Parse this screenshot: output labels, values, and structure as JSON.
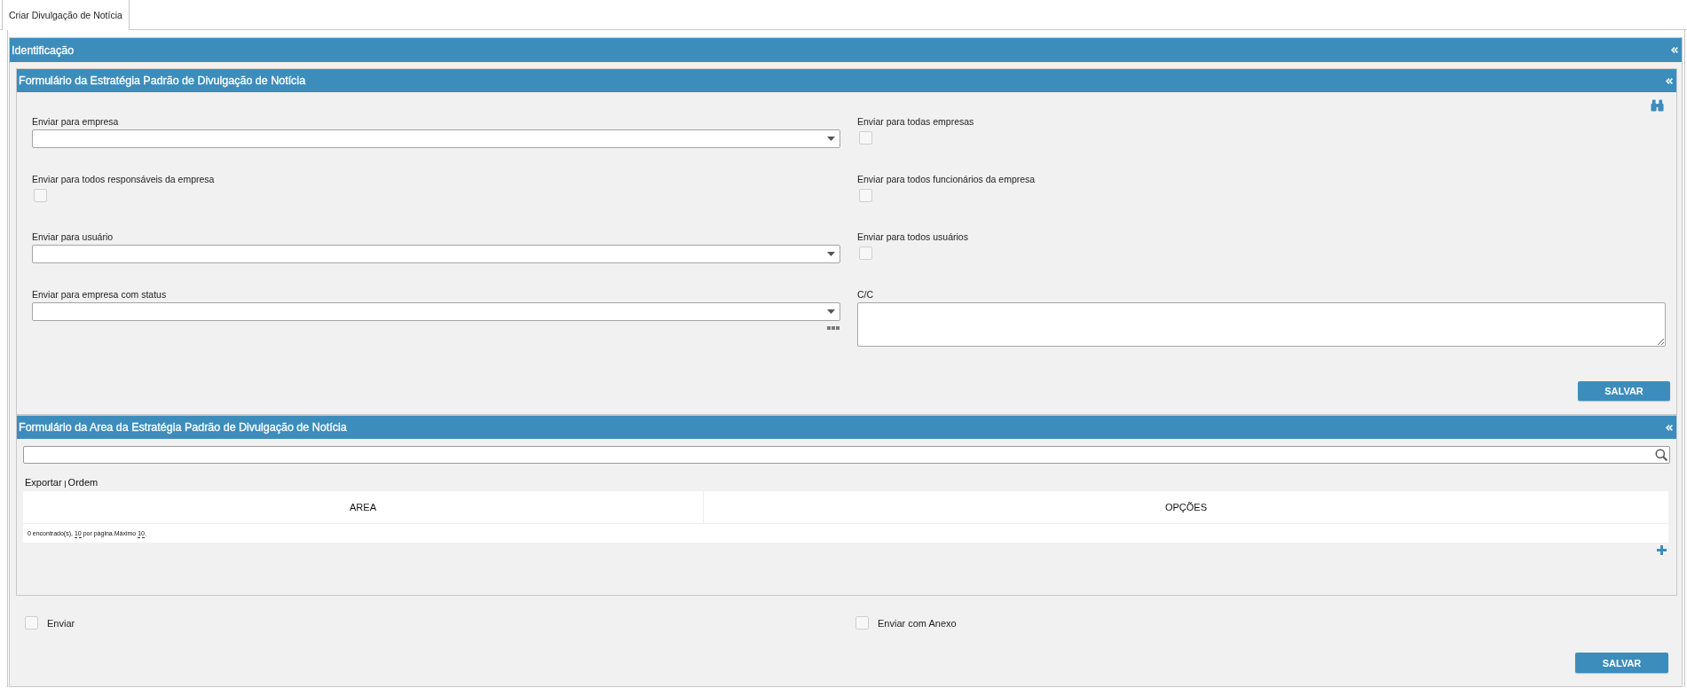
{
  "tab": {
    "label": "Criar Divulgação de Notícia",
    "selected": true
  },
  "identification": {
    "title": "Identificação",
    "strategy_form": {
      "title": "Formulário da Estratégia Padrão de Divulgação de Notícia",
      "fields": [
        {
          "kind": "select",
          "label": "Enviar para empresa"
        },
        {
          "kind": "checkbox",
          "label": "Enviar para todas empresas",
          "checked": false
        },
        {
          "kind": "checkbox",
          "label": "Enviar para todos responsáveis da empresa",
          "checked": false
        },
        {
          "kind": "checkbox",
          "label": "Enviar para todos funcionários da empresa",
          "checked": false
        },
        {
          "kind": "select",
          "label": "Enviar para usuário"
        },
        {
          "kind": "checkbox",
          "label": "Enviar para todos usuários",
          "checked": false
        },
        {
          "kind": "select",
          "label": "Enviar para empresa com status",
          "more_button": true
        },
        {
          "kind": "textarea",
          "label": "C/C"
        }
      ],
      "save_button": "SALVAR"
    },
    "area_form": {
      "title": "Formulário da Area da Estratégia Padrão de Divulgação de Notícia",
      "actions": [
        "Exportar",
        "Ordem"
      ],
      "table": {
        "columns": [
          "AREA",
          "OPÇÕES"
        ],
        "summary": [
          {
            "text": "0 encontrado(s), ",
            "link": false
          },
          {
            "text": "10",
            "link": true
          },
          {
            "text": " por página.Máximo ",
            "link": false
          },
          {
            "text": "10",
            "link": true
          },
          {
            "text": ".",
            "link": false
          }
        ]
      }
    },
    "options": [
      {
        "label": "Enviar",
        "checked": false
      },
      {
        "label": "Enviar com Anexo",
        "checked": false
      }
    ],
    "save_button": "SALVAR"
  }
}
